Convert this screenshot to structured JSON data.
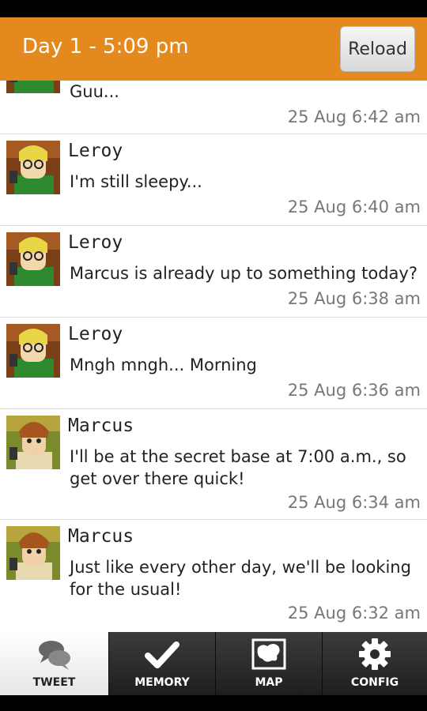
{
  "header": {
    "title": "Day 1 - 5:09 pm",
    "reload_label": "Reload"
  },
  "feed": {
    "partial_item": {
      "message": "Guu...",
      "time": "25 Aug 6:42 am"
    },
    "items": [
      {
        "name": "Leroy",
        "message": "I'm still sleepy...",
        "time": "25 Aug 6:40 am"
      },
      {
        "name": "Leroy",
        "message": "Marcus is already up to something today?",
        "time": "25 Aug 6:38 am"
      },
      {
        "name": "Leroy",
        "message": "Mngh mngh... Morning",
        "time": "25 Aug 6:36 am"
      },
      {
        "name": "Marcus",
        "message": "I'll be at the secret base at 7:00 a.m., so get over there quick!",
        "time": "25 Aug 6:34 am"
      },
      {
        "name": "Marcus",
        "message": "Just like every other day, we'll be looking for the usual!",
        "time": "25 Aug 6:32 am"
      }
    ]
  },
  "tabs": [
    {
      "label": "TWEET",
      "icon": "speech-bubbles-icon",
      "active": true
    },
    {
      "label": "MEMORY",
      "icon": "checkmark-icon",
      "active": false
    },
    {
      "label": "MAP",
      "icon": "map-icon",
      "active": false
    },
    {
      "label": "CONFIG",
      "icon": "gear-icon",
      "active": false
    }
  ],
  "colors": {
    "header": "#e4891e",
    "divider": "#dcdcdc",
    "time_text": "#777777"
  }
}
